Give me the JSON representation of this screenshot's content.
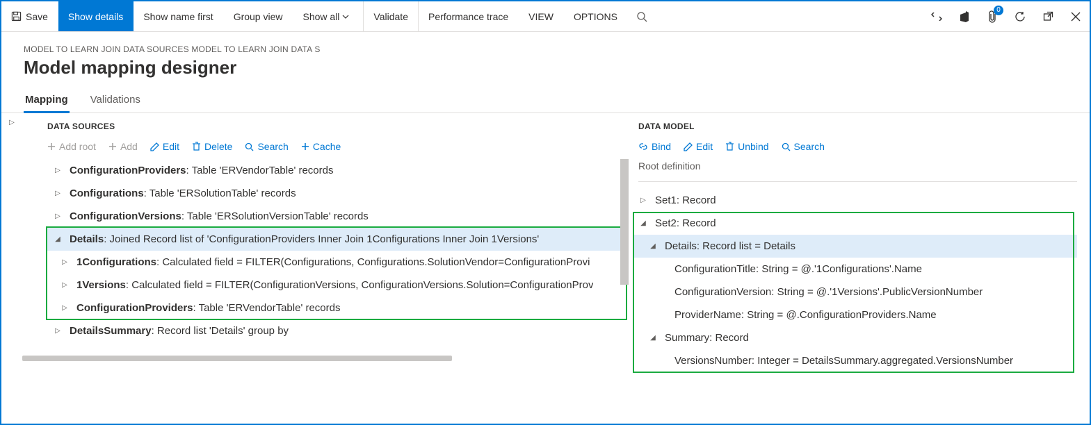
{
  "toolbar": {
    "save": "Save",
    "show_details": "Show details",
    "show_name_first": "Show name first",
    "group_view": "Group view",
    "show_all": "Show all",
    "validate": "Validate",
    "perf_trace": "Performance trace",
    "view": "VIEW",
    "options": "OPTIONS",
    "badge": "0"
  },
  "breadcrumb": "MODEL TO LEARN JOIN DATA SOURCES MODEL TO LEARN JOIN DATA S",
  "page_title": "Model mapping designer",
  "tabs": {
    "mapping": "Mapping",
    "validations": "Validations"
  },
  "ds": {
    "heading": "DATA SOURCES",
    "cmd_add_root": "Add root",
    "cmd_add": "Add",
    "cmd_edit": "Edit",
    "cmd_delete": "Delete",
    "cmd_search": "Search",
    "cmd_cache": "Cache",
    "rows": [
      {
        "name": "ConfigurationProviders",
        "rest": ": Table 'ERVendorTable' records"
      },
      {
        "name": "Configurations",
        "rest": ": Table 'ERSolutionTable' records"
      },
      {
        "name": "ConfigurationVersions",
        "rest": ": Table 'ERSolutionVersionTable' records"
      },
      {
        "name": "Details",
        "rest": ": Joined Record list of 'ConfigurationProviders Inner Join 1Configurations Inner Join 1Versions'"
      },
      {
        "name": "1Configurations",
        "rest": ": Calculated field = FILTER(Configurations, Configurations.SolutionVendor=ConfigurationProvi"
      },
      {
        "name": "1Versions",
        "rest": ": Calculated field = FILTER(ConfigurationVersions, ConfigurationVersions.Solution=ConfigurationProv"
      },
      {
        "name": "ConfigurationProviders",
        "rest": ": Table 'ERVendorTable' records"
      },
      {
        "name": "DetailsSummary",
        "rest": ": Record list 'Details' group by"
      }
    ]
  },
  "dm": {
    "heading": "DATA MODEL",
    "cmd_bind": "Bind",
    "cmd_edit": "Edit",
    "cmd_unbind": "Unbind",
    "cmd_search": "Search",
    "sub": "Root definition",
    "rows": [
      "Set1: Record",
      "Set2: Record",
      "Details: Record list = Details",
      "ConfigurationTitle: String = @.'1Configurations'.Name",
      "ConfigurationVersion: String = @.'1Versions'.PublicVersionNumber",
      "ProviderName: String = @.ConfigurationProviders.Name",
      "Summary: Record",
      "VersionsNumber: Integer = DetailsSummary.aggregated.VersionsNumber"
    ]
  }
}
